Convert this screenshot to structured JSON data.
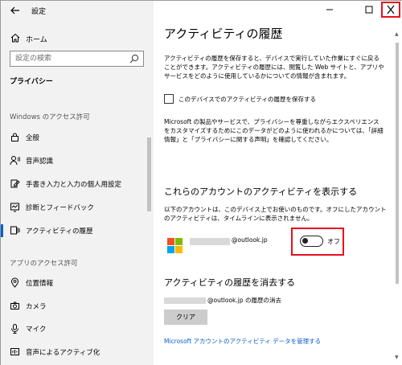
{
  "window": {
    "title": "設定",
    "controls": {
      "minimize": "minimize-icon",
      "maximize": "maximize-icon",
      "close": "close-icon",
      "close_highlight_color": "#e8101e"
    }
  },
  "sidebar": {
    "home_label": "ホーム",
    "search_placeholder": "設定の検索",
    "section_title": "プライバシー",
    "windows_permissions_heading": "Windows のアクセス許可",
    "windows_items": [
      {
        "label": "全般",
        "icon": "lock-icon"
      },
      {
        "label": "音声認識",
        "icon": "speech-icon"
      },
      {
        "label": "手書き入力と入力の個人用設定",
        "icon": "pen-icon"
      },
      {
        "label": "診断とフィードバック",
        "icon": "diagnostics-icon"
      },
      {
        "label": "アクティビティの履歴",
        "icon": "history-icon",
        "selected": true
      }
    ],
    "app_permissions_heading": "アプリのアクセス許可",
    "app_items": [
      {
        "label": "位置情報",
        "icon": "location-icon"
      },
      {
        "label": "カメラ",
        "icon": "camera-icon"
      },
      {
        "label": "マイク",
        "icon": "microphone-icon"
      },
      {
        "label": "音声によるアクティブ化",
        "icon": "voice-activation-icon"
      }
    ],
    "accent_color": "#0a5fc8"
  },
  "main": {
    "title": "アクティビティの履歴",
    "intro_text": "アクティビティの履歴を保存すると、デバイスで実行していた作業にすぐに戻ることができます。アクティビティの履歴には、閲覧した Web サイトと、アプリやサービスをどのように使用しているかについての情報が含まれます。",
    "save_history_checkbox": {
      "label": "このデバイスでのアクティビティの履歴を保存する",
      "checked": false
    },
    "privacy_text": "Microsoft の製品やサービスで、プライバシーを尊重しながらエクスペリエンスをカスタマイズするためにこのデータがどのように使われるかについては、「詳細情報」と「プライバシーに関する声明」を確認してください。",
    "accounts_heading": "これらのアカウントのアクティビティを表示する",
    "accounts_text": "以下のアカウントは、このデバイス上でお使いのものです。オフにしたアカウントのアクティビティは、タイムラインに表示されません。",
    "account": {
      "email_domain": "@outlook.jp",
      "toggle_label": "オフ",
      "toggle_on": false
    },
    "clear_heading": "アクティビティの履歴を消去する",
    "clear_text": "@outlook.jp の履歴の消去",
    "clear_button": "クリア",
    "manage_link": "Microsoft アカウントのアクティビティ データを管理する",
    "link_color": "#0a5fc8",
    "highlight_color": "#e8101e"
  }
}
